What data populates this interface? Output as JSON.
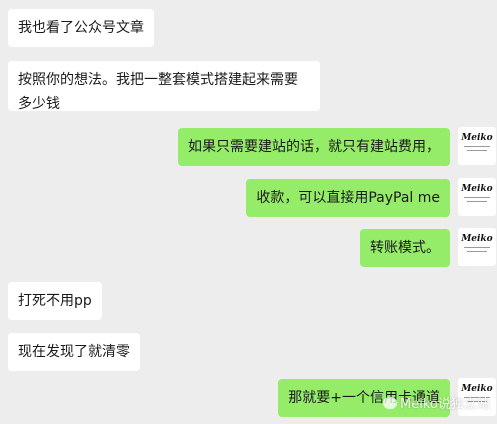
{
  "messages": [
    {
      "side": "left",
      "text": "我也看了公众号文章"
    },
    {
      "side": "left",
      "text": "按照你的想法。我把一整套模式搭建起来需要多少钱"
    },
    {
      "side": "right",
      "text": "如果只需要建站的话，就只有建站费用，"
    },
    {
      "side": "right",
      "text": "收款，可以直接用PayPal me"
    },
    {
      "side": "right",
      "text": "转账模式。"
    },
    {
      "side": "left",
      "text": "打死不用pp"
    },
    {
      "side": "left",
      "text": "现在发现了就清零"
    },
    {
      "side": "right",
      "text": "那就要+一个信用卡通道"
    }
  ],
  "avatar": {
    "logo_text": "Meiko"
  },
  "watermark": {
    "text": "Meiko说独立站"
  },
  "colors": {
    "background": "#ededed",
    "left_bubble": "#ffffff",
    "right_bubble": "#95ec69"
  }
}
